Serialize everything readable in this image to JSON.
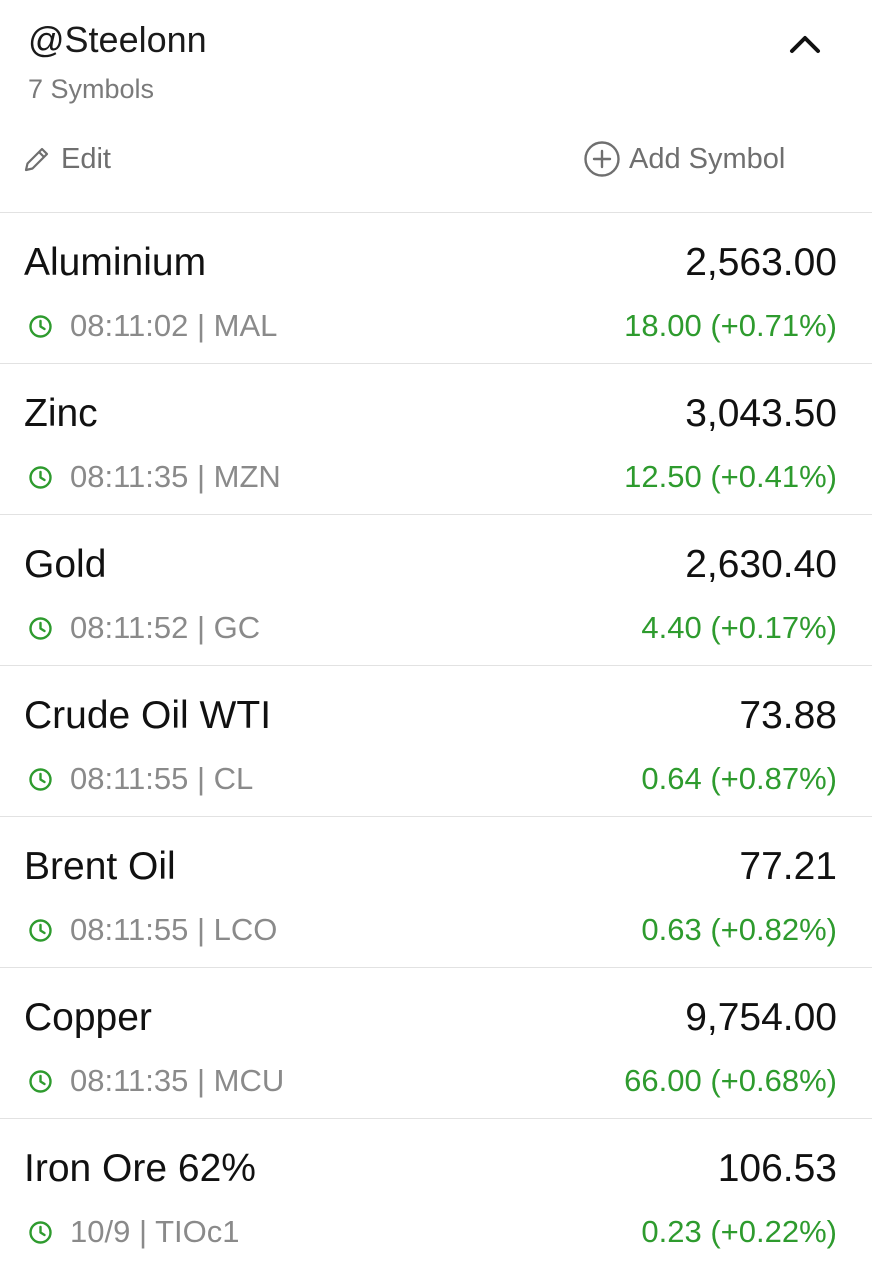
{
  "watchlist": {
    "title": "@Steelonn",
    "count_label": "7 Symbols",
    "collapse_icon": "chevron-up-icon",
    "edit_label": "Edit",
    "edit_icon": "pencil-icon",
    "add_label": "Add Symbol",
    "add_icon": "plus-circle-icon"
  },
  "colors": {
    "positive": "#2e9b2e",
    "muted_text": "#8a8a8a",
    "divider": "#e2e2e2"
  },
  "items": [
    {
      "name": "Aluminium",
      "price": "2,563.00",
      "time": "08:11:02",
      "ticker": "MAL",
      "change": "18.00 (+0.71%)"
    },
    {
      "name": "Zinc",
      "price": "3,043.50",
      "time": "08:11:35",
      "ticker": "MZN",
      "change": "12.50 (+0.41%)"
    },
    {
      "name": "Gold",
      "price": "2,630.40",
      "time": "08:11:52",
      "ticker": "GC",
      "change": "4.40 (+0.17%)"
    },
    {
      "name": "Crude Oil WTI",
      "price": "73.88",
      "time": "08:11:55",
      "ticker": "CL",
      "change": "0.64 (+0.87%)"
    },
    {
      "name": "Brent Oil",
      "price": "77.21",
      "time": "08:11:55",
      "ticker": "LCO",
      "change": "0.63 (+0.82%)"
    },
    {
      "name": "Copper",
      "price": "9,754.00",
      "time": "08:11:35",
      "ticker": "MCU",
      "change": "66.00 (+0.68%)"
    },
    {
      "name": "Iron Ore 62%",
      "price": "106.53",
      "time": "10/9",
      "ticker": "TIOc1",
      "change": "0.23 (+0.22%)"
    }
  ]
}
